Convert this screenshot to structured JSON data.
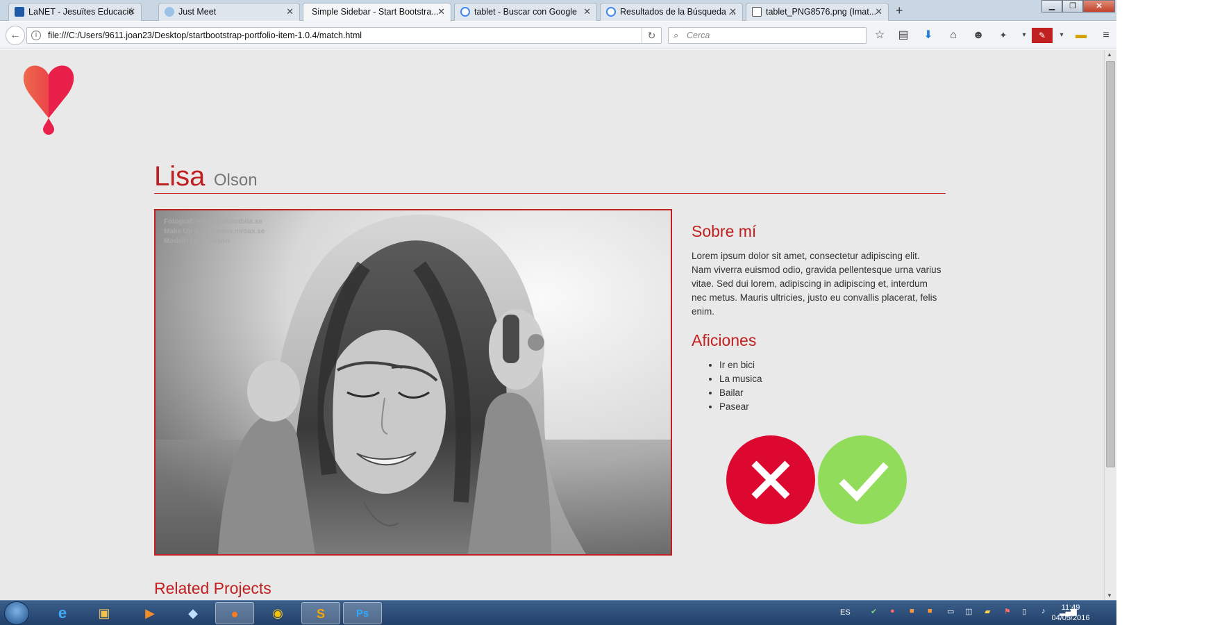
{
  "browser": {
    "tabs": [
      {
        "label": "LaNET - Jesuïtes Educació",
        "active": false
      },
      {
        "label": "Just Meet",
        "active": false
      },
      {
        "label": "Simple Sidebar - Start Bootstra...",
        "active": true
      },
      {
        "label": "tablet - Buscar con Google",
        "active": false
      },
      {
        "label": "Resultados de la Búsqueda ...",
        "active": false
      },
      {
        "label": "tablet_PNG8576.png (Imat...",
        "active": false
      }
    ],
    "url": "file:///C:/Users/9611.joan23/Desktop/startbootstrap-portfolio-item-1.0.4/match.html",
    "search_placeholder": "Cerca"
  },
  "profile": {
    "first_name": "Lisa",
    "last_name": "Olson",
    "photo_credits": [
      "Fotograf: www.lindellotblia.se",
      "Make Up Artist: www.mroax.se",
      "Modell: Lisa Olsson"
    ],
    "about_heading": "Sobre mí",
    "about_text": "Lorem ipsum dolor sit amet, consectetur adipiscing elit. Nam viverra euismod odio, gravida pellentesque urna varius vitae. Sed dui lorem, adipiscing in adipiscing et, interdum nec metus. Mauris ultricies, justo eu convallis placerat, felis enim.",
    "hobbies_heading": "Aficiones",
    "hobbies": [
      "Ir en bici",
      "La musica",
      "Bailar",
      "Pasear"
    ],
    "related_heading": "Related Projects"
  },
  "actions": {
    "reject_icon": "close-icon",
    "accept_icon": "check-icon",
    "reject_color": "#dc0830",
    "accept_color": "#91dd5b"
  },
  "taskbar": {
    "language": "ES",
    "time": "11:49",
    "date": "04/05/2016"
  },
  "colors": {
    "accent": "#c0201f",
    "page_background": "#e9e9e9"
  }
}
